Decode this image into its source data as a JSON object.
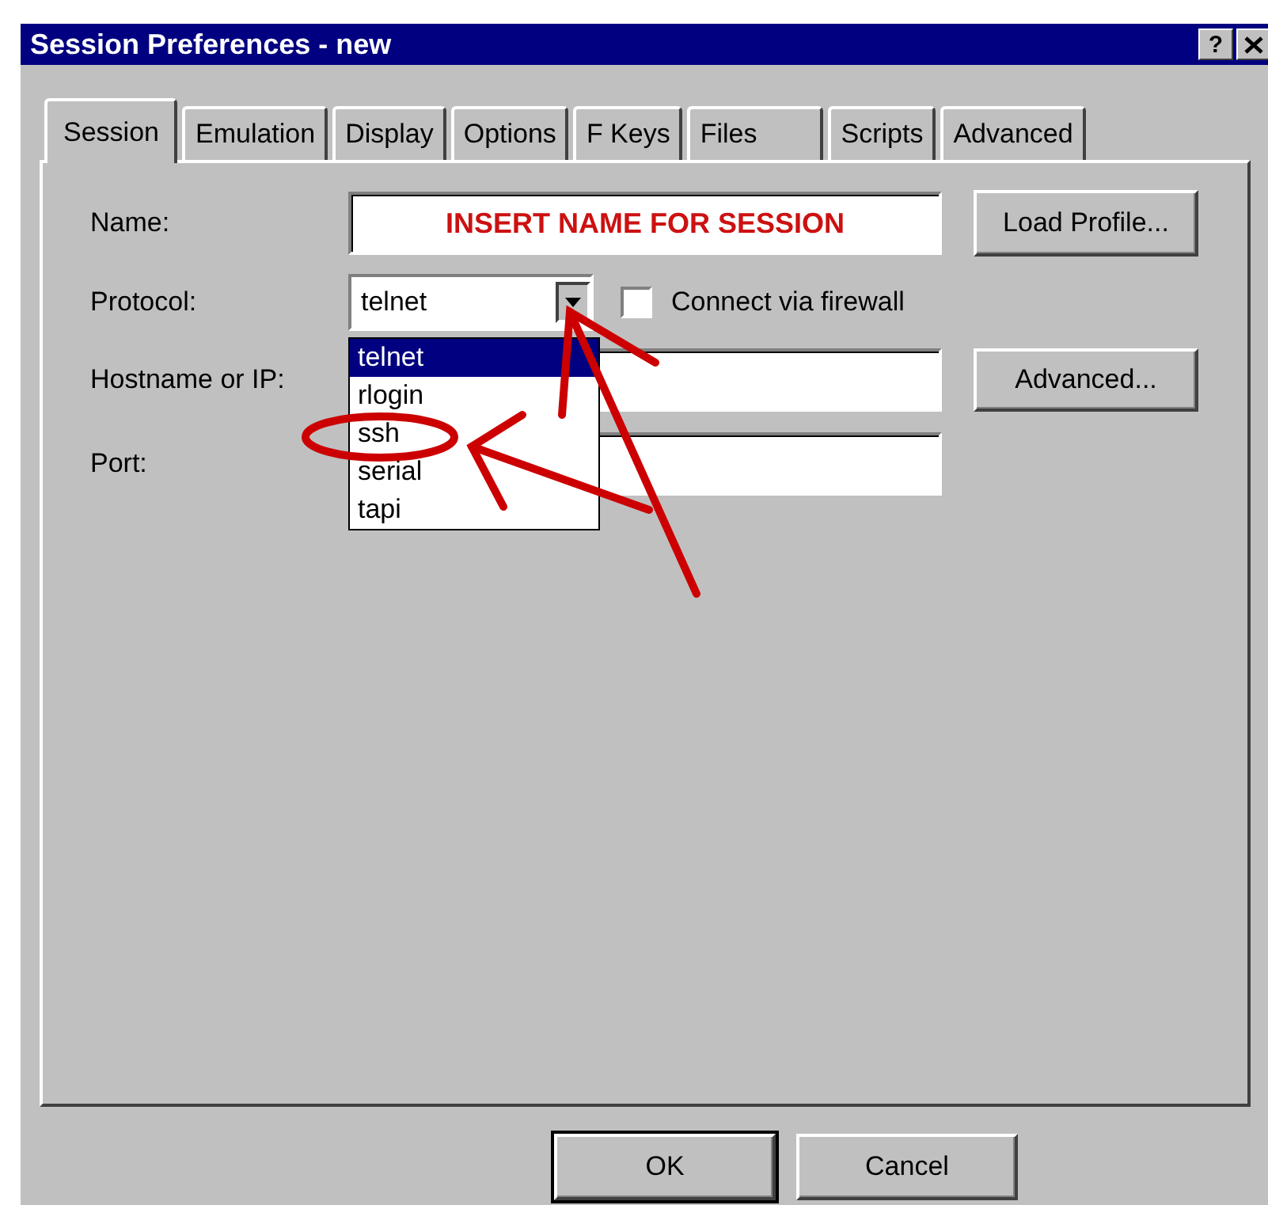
{
  "window": {
    "title": "Session Preferences - new",
    "help_button": "?"
  },
  "tabs": [
    {
      "label": "Session",
      "selected": true
    },
    {
      "label": "Emulation",
      "selected": false
    },
    {
      "label": "Display",
      "selected": false
    },
    {
      "label": "Options",
      "selected": false
    },
    {
      "label": "F Keys",
      "selected": false
    },
    {
      "label": "Files",
      "selected": false
    },
    {
      "label": "Scripts",
      "selected": false
    },
    {
      "label": "Advanced",
      "selected": false
    }
  ],
  "form": {
    "name": {
      "label": "Name:",
      "value": "INSERT NAME FOR SESSION"
    },
    "load_profile_button": "Load Profile...",
    "protocol": {
      "label": "Protocol:",
      "value": "telnet",
      "expanded": true,
      "options": [
        {
          "label": "telnet",
          "selected": true
        },
        {
          "label": "rlogin",
          "selected": false
        },
        {
          "label": "ssh",
          "selected": false
        },
        {
          "label": "serial",
          "selected": false
        },
        {
          "label": "tapi",
          "selected": false
        }
      ]
    },
    "firewall": {
      "label": "Connect via firewall",
      "checked": false
    },
    "hostname": {
      "label": "Hostname or IP:"
    },
    "advanced_button": "Advanced...",
    "port": {
      "label": "Port:"
    }
  },
  "buttons": [
    {
      "label": "OK",
      "default": true
    },
    {
      "label": "Cancel",
      "default": false
    }
  ],
  "annotations": [
    {
      "kind": "ellipse"
    },
    {
      "kind": "arrow"
    },
    {
      "kind": "arrow"
    }
  ]
}
